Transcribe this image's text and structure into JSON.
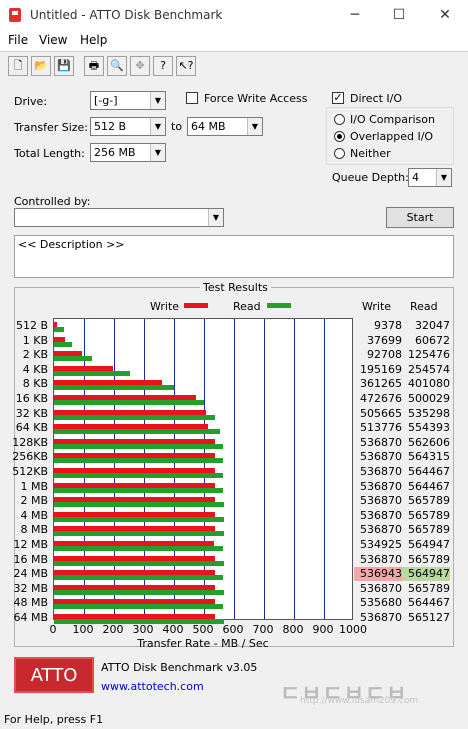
{
  "window": {
    "title": "Untitled - ATTO Disk Benchmark",
    "minimize": "─",
    "maximize": "☐",
    "close": "✕"
  },
  "menu": [
    "File",
    "View",
    "Help"
  ],
  "toolbar": [
    {
      "name": "new-icon",
      "glyph": "🗋"
    },
    {
      "name": "open-icon",
      "glyph": "📂"
    },
    {
      "name": "save-icon",
      "glyph": "💾"
    },
    {
      "name": "print-icon",
      "glyph": "🖶"
    },
    {
      "name": "print-preview-icon",
      "glyph": "🔍"
    },
    {
      "name": "move-icon",
      "glyph": "✥"
    },
    {
      "name": "help-icon",
      "glyph": "?"
    },
    {
      "name": "context-help-icon",
      "glyph": "↖?"
    }
  ],
  "settings": {
    "drive_label": "Drive:",
    "drive_value": "[-g-]",
    "transfer_size_label": "Transfer Size:",
    "transfer_from": "512 B",
    "to_label": "to",
    "transfer_to": "64 MB",
    "total_length_label": "Total Length:",
    "total_length": "256 MB",
    "force_write_label": "Force Write Access",
    "force_write_checked": false,
    "direct_io_label": "Direct I/O",
    "direct_io_checked": true,
    "io_comparison_label": "I/O Comparison",
    "overlapped_io_label": "Overlapped I/O",
    "neither_label": "Neither",
    "selected_mode": "overlapped",
    "queue_depth_label": "Queue Depth:",
    "queue_depth": "4",
    "controlled_by_label": "Controlled by:",
    "controlled_by_value": "",
    "start_label": "Start",
    "description": "<< Description >>"
  },
  "results": {
    "group_title": "Test Results",
    "legend_write": "Write",
    "legend_read": "Read",
    "col_write": "Write",
    "col_read": "Read",
    "xlabel": "Transfer Rate - MB / Sec",
    "write_color": "#e8141b",
    "read_color": "#23a02c",
    "highlight_write_color": "#f4a7a7",
    "highlight_read_color": "#b9d9a0"
  },
  "chart_data": {
    "type": "bar",
    "orientation": "horizontal",
    "xlim": [
      0,
      1000
    ],
    "xticks": [
      "0",
      "100",
      "200",
      "300",
      "400",
      "500",
      "600",
      "700",
      "800",
      "900",
      "1000"
    ],
    "categories": [
      "512 B",
      "1 KB",
      "2 KB",
      "4 KB",
      "8 KB",
      "16 KB",
      "32 KB",
      "64 KB",
      "128KB",
      "256KB",
      "512KB",
      "1 MB",
      "2 MB",
      "4 MB",
      "8 MB",
      "12 MB",
      "16 MB",
      "24 MB",
      "32 MB",
      "48 MB",
      "64 MB"
    ],
    "write_text": [
      "9378",
      "37699",
      "92708",
      "195169",
      "361265",
      "472676",
      "505665",
      "513776",
      "536870",
      "536870",
      "536870",
      "536870",
      "536870",
      "536870",
      "536870",
      "534925",
      "536870",
      "536943",
      "536870",
      "535680",
      "536870"
    ],
    "read_text": [
      "32047",
      "60672",
      "125476",
      "254574",
      "401080",
      "500029",
      "535298",
      "554393",
      "562606",
      "564315",
      "564467",
      "564467",
      "565789",
      "565789",
      "565789",
      "564947",
      "565789",
      "564947",
      "565789",
      "564467",
      "565127"
    ],
    "series": [
      {
        "name": "Write",
        "values": [
          9.4,
          37.7,
          92.7,
          195.2,
          361.3,
          472.7,
          505.7,
          513.8,
          536.9,
          536.9,
          536.9,
          536.9,
          536.9,
          536.9,
          536.9,
          534.9,
          536.9,
          536.9,
          536.9,
          535.7,
          536.9
        ]
      },
      {
        "name": "Read",
        "values": [
          32.0,
          60.7,
          125.5,
          254.6,
          401.1,
          500.0,
          535.3,
          554.4,
          562.6,
          564.3,
          564.5,
          564.5,
          565.8,
          565.8,
          565.8,
          564.9,
          565.8,
          564.9,
          565.8,
          564.5,
          565.1
        ]
      }
    ],
    "highlight_row": 17
  },
  "footer": {
    "logo_text": "ATTO",
    "product": "ATTO Disk Benchmark v3.05",
    "link": "www.attotech.com",
    "watermark": "ㄷㅂㄷㅂㄷㅂ",
    "watermark_url": "http://www.idsam209.com",
    "status": "For Help, press F1"
  }
}
